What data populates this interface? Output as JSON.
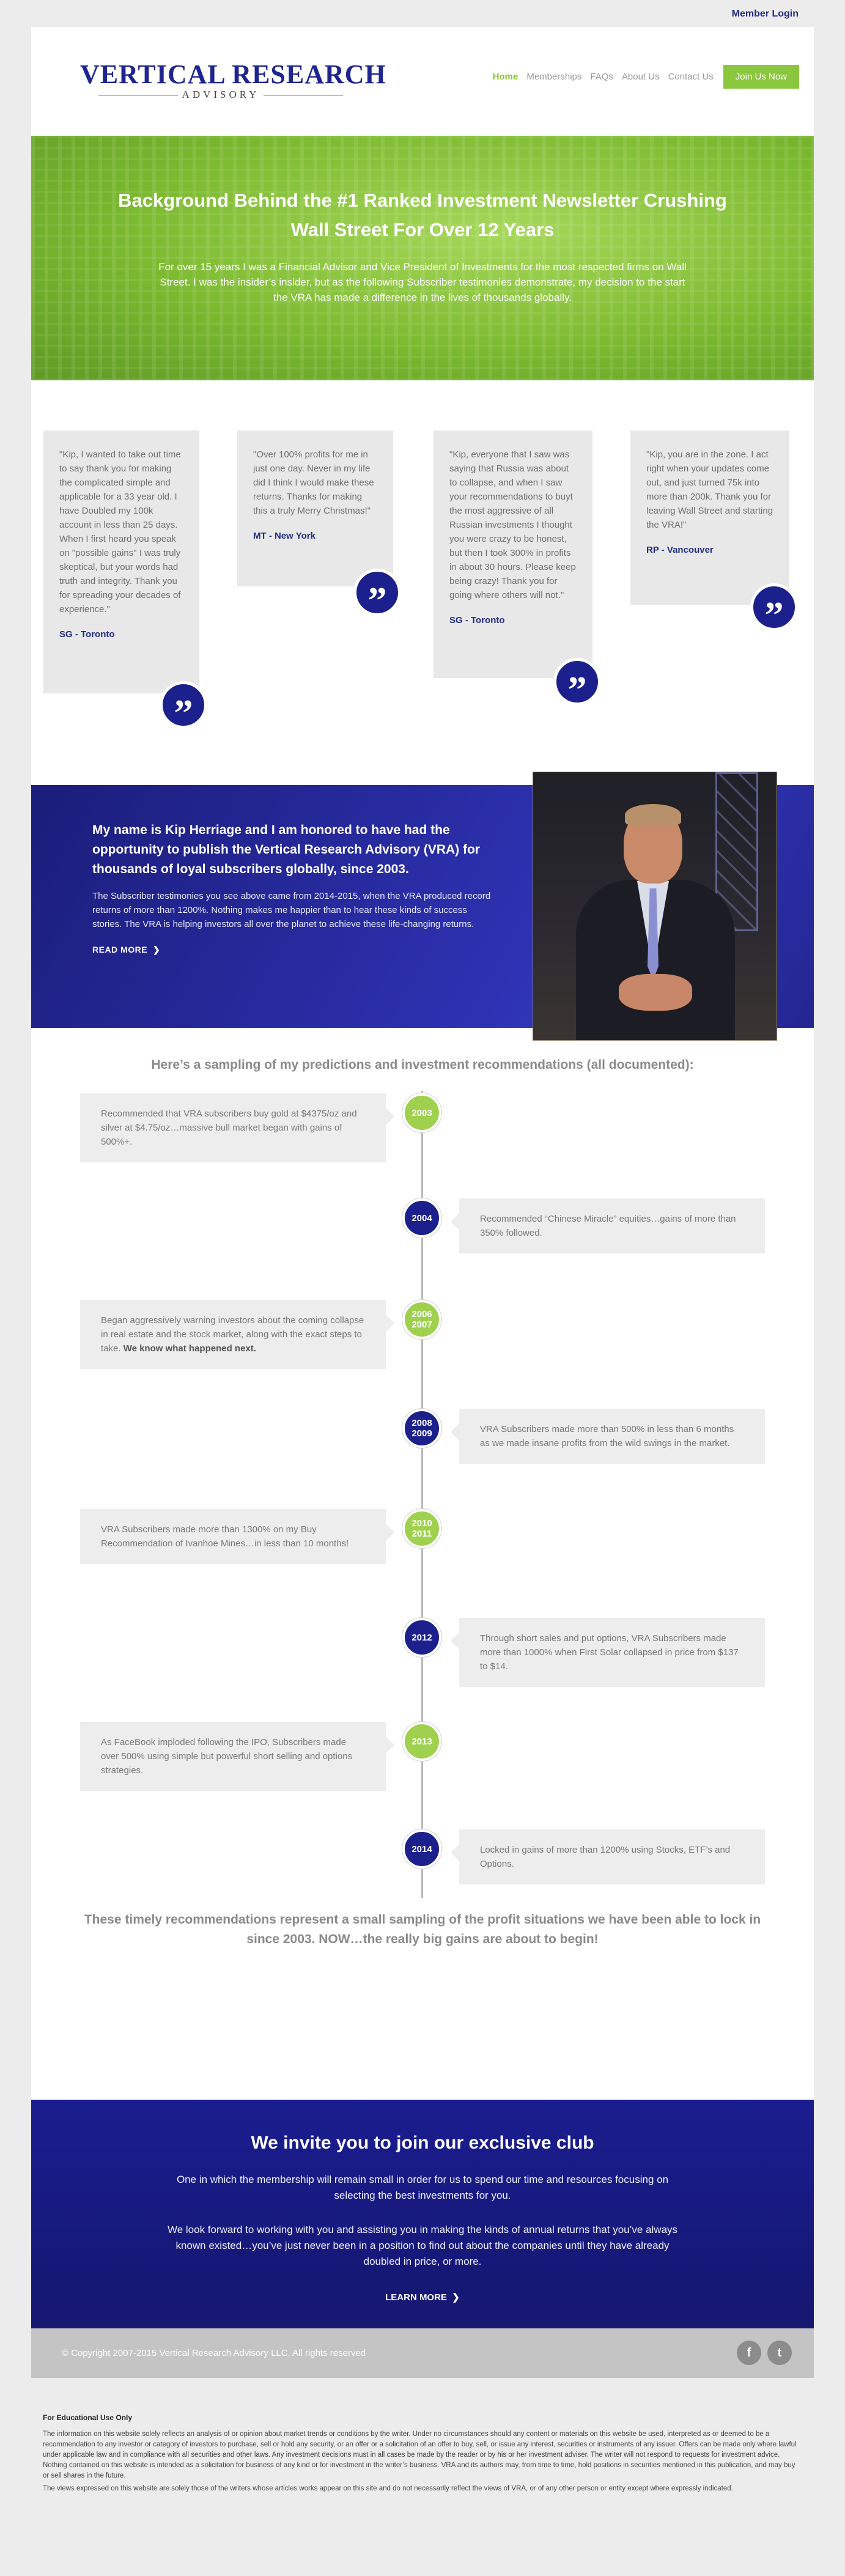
{
  "topbar": {
    "member_login": "Member Login"
  },
  "header": {
    "logo_main": "VERTICAL RESEARCH",
    "logo_sub": "ADVISORY",
    "nav": [
      "Home",
      "Memberships",
      "FAQs",
      "About Us",
      "Contact Us"
    ],
    "join_label": "Join Us Now"
  },
  "hero": {
    "title": "Background Behind the #1 Ranked Investment Newsletter Crushing Wall Street For Over 12 Years",
    "body": "For over 15 years I was a Financial Advisor and Vice President of Investments for the most respected firms on Wall Street. I was the insider’s insider, but as the following Subscriber testimonies demonstrate, my decision to the start the VRA has made a difference in the lives of thousands globally."
  },
  "testimonials": [
    {
      "quote": "\"Kip, I wanted to take out time to say thank you for making the complicated simple and applicable for a 33 year old. I have Doubled my 100k account in less than 25 days. When I first heard you speak on \"possible gains\" I was truly skeptical, but your words had truth and integrity. Thank you for spreading your decades of experience.\"",
      "author": "SG - Toronto"
    },
    {
      "quote": "\"Over 100% profits for me in just one day. Never in my life did I think I would make these returns. Thanks for making this a truly Merry Christmas!\"",
      "author": "MT - New York"
    },
    {
      "quote": "\"Kip, everyone that I saw was saying that Russia was about to collapse, and when I saw your recommendations to buyt the most aggressive of all Russian investments I thought you were crazy to be honest, but then I took 300% in profits in about 30 hours. Please keep being crazy! Thank you for going where others will not.\"",
      "author": "SG - Toronto"
    },
    {
      "quote": "\"Kip, you are in the zone. I act right when your updates come out, and just turned 75k into more than 200k. Thank you for leaving Wall Street and starting the VRA!\"",
      "author": "RP - Vancouver"
    }
  ],
  "quote_glyph": "”",
  "about": {
    "heading": "My name is Kip Herriage and I am honored to have had the opportunity to publish the Vertical Research Advisory (VRA) for thousands of loyal subscribers globally, since 2003.",
    "body": "The Subscriber testimonies you see above came from 2014-2015, when the VRA produced record returns of more than 1200%. Nothing makes me happier than to hear these kinds of success stories. The VRA is helping investors all over the planet to achieve these life-changing returns.",
    "read_more": "READ MORE"
  },
  "sampling_title": "Here’s a sampling of my predictions and investment recommendations (all documented):",
  "timeline": [
    {
      "year": "2003",
      "text": "Recommended that VRA subscribers buy gold at $4375/oz and silver at $4.75/oz…massive bull market began with gains of 500%+.",
      "bold": ""
    },
    {
      "year": "2004",
      "text": "Recommended “Chinese Miracle” equities…gains of more than 350% followed.",
      "bold": ""
    },
    {
      "year": "2006\n2007",
      "text": "Began aggressively warning investors about the coming collapse in real estate and the stock market, along with the exact steps to take. ",
      "bold": "We know what happened next."
    },
    {
      "year": "2008\n2009",
      "text": "VRA Subscribers made more than 500% in less than 6 months as we made insane profits from the wild swings in the market.",
      "bold": ""
    },
    {
      "year": "2010\n2011",
      "text": "VRA Subscribers made more than 1300% on my Buy Recommendation of Ivanhoe Mines…in less than 10 months!",
      "bold": ""
    },
    {
      "year": "2012",
      "text": "Through short sales and put options, VRA Subscribers made more than 1000% when First Solar collapsed in price from $137 to $14.",
      "bold": ""
    },
    {
      "year": "2013",
      "text": "As FaceBook imploded following the IPO, Subscribers made over 500% using simple but powerful short selling and options strategies.",
      "bold": ""
    },
    {
      "year": "2014",
      "text": "Locked in gains of more than 1200% using Stocks, ETF’s and Options.",
      "bold": ""
    }
  ],
  "closing": "These timely recommendations represent a small sampling of the profit situations we have been able to lock in since 2003. NOW…the really big gains are about to begin!",
  "invite": {
    "title": "We invite you to join our exclusive club",
    "p1": "One in which the membership will remain small in order for us to spend our time and resources focusing on selecting the best investments for you.",
    "p2": "We look forward to working with you and assisting you in making the kinds of annual returns that you’ve always known existed…you’ve just never been in a position to find out about the companies until they have already doubled in price, or more.",
    "learn_more": "LEARN MORE"
  },
  "footer": {
    "copyright": "© Copyright 2007-2015 Vertical Research Advisory LLC. All rights reserved",
    "social": [
      "f",
      "t"
    ]
  },
  "disclaimer": {
    "title": "For Educational Use Only",
    "p1": "The information on this website solely reflects an analysis of or opinion about market trends or conditions by the writer. Under no circumstances should any content or materials on this website be used, interpreted as or deemed to be a recommendation to any investor or category of investors to purchase, sell or hold any security, or an offer or a solicitation of an offer to buy, sell, or issue any interest, securities or instruments of any issuer. Offers can be made only where lawful under applicable law and in compliance with all securities and other laws. Any investment decisions must in all cases be made by the reader or by his or her investment adviser. The writer will not respond to requests for investment advice. Nothing contained on this website is intended as a solicitation for business of any kind or for investment in the writer’s business. VRA and its authors may, from time to time, hold positions in securities mentioned in this publication, and may buy or sell shares in the future.",
    "p2": "The views expressed on this website are solely those of the writers whose articles works appear on this site and do not necessarily reflect the views of VRA, or of any other person or entity except where expressly indicated."
  },
  "colors": {
    "brand_blue": "#1c208c",
    "brand_green": "#8bc63f"
  }
}
